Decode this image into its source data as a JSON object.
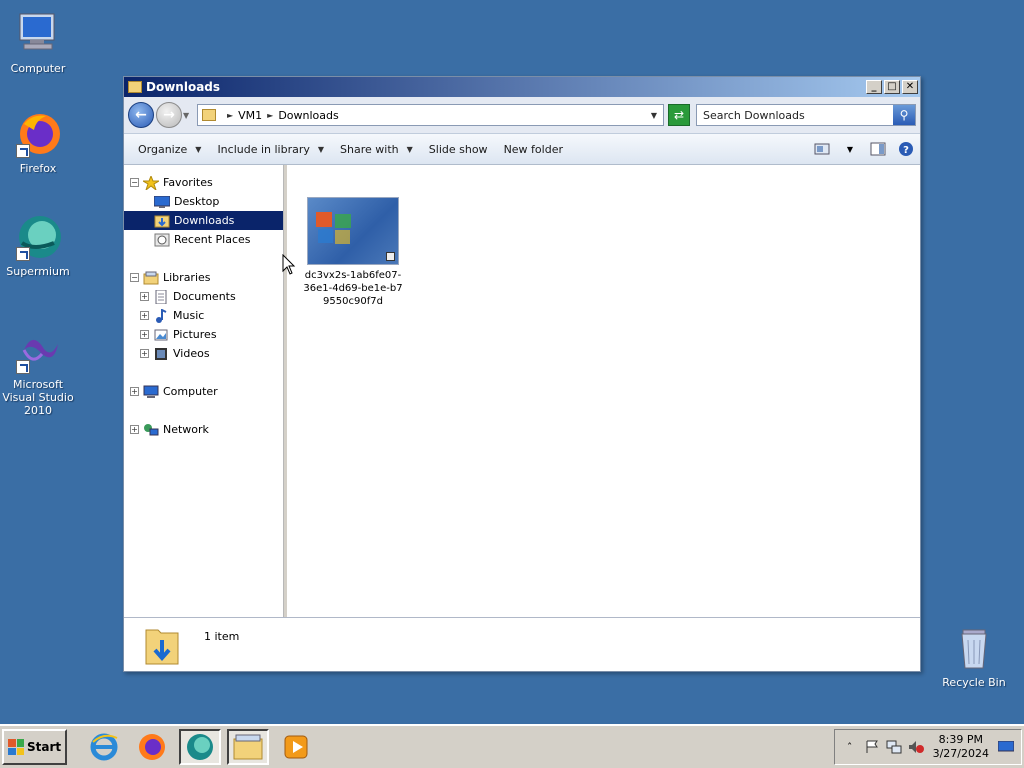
{
  "desktop": {
    "icons": [
      {
        "label": "Computer"
      },
      {
        "label": "Firefox"
      },
      {
        "label": "Supermium"
      },
      {
        "label": "Microsoft Visual Studio 2010"
      },
      {
        "label": "Recycle Bin"
      }
    ]
  },
  "window": {
    "title": "Downloads",
    "controls": {
      "minimize": "_",
      "maximize": "□",
      "close": "✕"
    }
  },
  "address": {
    "segments": [
      "VM1",
      "Downloads"
    ],
    "search_placeholder": "Search Downloads"
  },
  "toolbar": {
    "organize": "Organize",
    "include_in_library": "Include in library",
    "share_with": "Share with",
    "slide_show": "Slide show",
    "new_folder": "New folder"
  },
  "nav_pane": {
    "favorites": "Favorites",
    "desktop": "Desktop",
    "downloads": "Downloads",
    "recent_places": "Recent Places",
    "libraries": "Libraries",
    "documents": "Documents",
    "music": "Music",
    "pictures": "Pictures",
    "videos": "Videos",
    "computer": "Computer",
    "network": "Network"
  },
  "files": [
    {
      "name": "dc3vx2s-1ab6fe07-36e1-4d69-be1e-b79550c90f7d"
    }
  ],
  "details": {
    "count": "1 item"
  },
  "taskbar": {
    "start": "Start",
    "time": "8:39 PM",
    "date": "3/27/2024"
  }
}
